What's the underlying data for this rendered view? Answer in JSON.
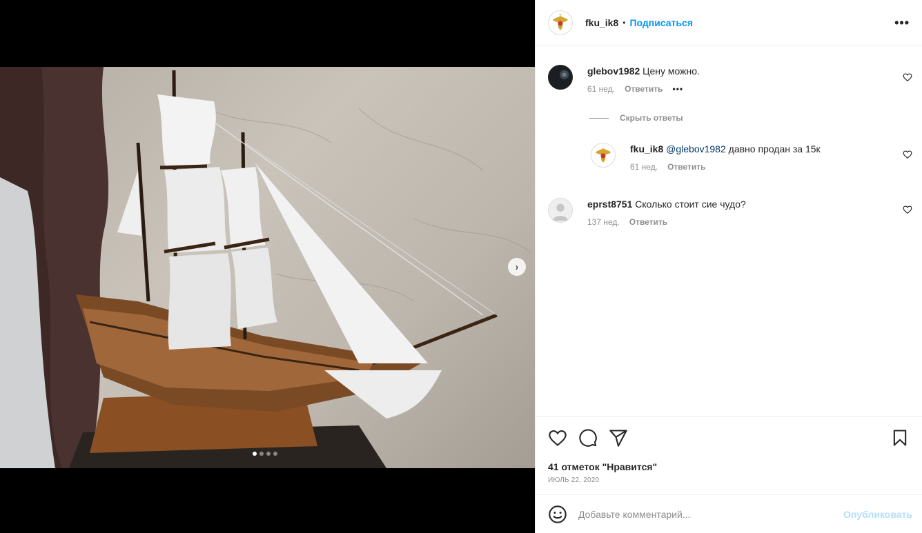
{
  "post": {
    "author": "fku_ik8",
    "separator": "•",
    "follow_label": "Подписаться",
    "more_label": "•••",
    "avatar_icon": "emblem-icon",
    "media": {
      "next_icon": "chevron-right-icon",
      "next_label": "›",
      "slide_count": 4,
      "active_slide": 1
    }
  },
  "comments": [
    {
      "username": "glebov1982",
      "text": "Цену можно.",
      "time": "61 нед.",
      "reply_label": "Ответить",
      "more_label": "•••",
      "avatar_icon": "user-avatar"
    },
    {
      "username": "eprst8751",
      "text": "Сколько стоит сие чудо?",
      "time": "137 нед.",
      "reply_label": "Ответить",
      "avatar_icon": "default-avatar-icon"
    }
  ],
  "replies_toggle": "Скрыть ответы",
  "reply": {
    "username": "fku_ik8",
    "mention": "@glebov1982",
    "text": " давно продан за 15к",
    "time": "61 нед.",
    "reply_label": "Ответить"
  },
  "footer": {
    "likes": "41 отметок \"Нравится\"",
    "date": "ИЮЛЬ 22, 2020",
    "comment_placeholder": "Добавьте комментарий...",
    "publish_label": "Опубликовать"
  },
  "colors": {
    "accent": "#0095f6",
    "publish_disabled": "#b2dffc",
    "muted": "#8e8e8e"
  }
}
